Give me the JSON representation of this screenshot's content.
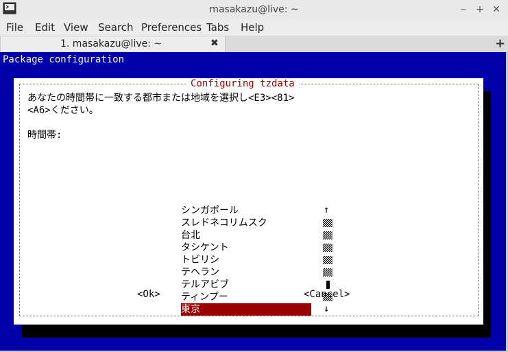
{
  "window": {
    "title": "masakazu@live: ~"
  },
  "menu": [
    "File",
    "Edit",
    "View",
    "Search",
    "Preferences",
    "Tabs",
    "Help"
  ],
  "tabs": [
    {
      "label": "1. masakazu@live: ~",
      "close_glyph": "✖"
    }
  ],
  "new_tab_glyph": "+",
  "terminal": {
    "header": "Package configuration",
    "dialog": {
      "title": "Configuring tzdata",
      "prompt_line1": "あなたの時間帯に一致する都市または地域を選択し<E3><81>",
      "prompt_line2": "<A6>ください。",
      "field_label": "時間帯:",
      "options": [
        "シンガポール",
        "スレドネコリムスク",
        "台北",
        "タシケント",
        "トビリシ",
        "テヘラン",
        "テルアビブ",
        "ティンプー",
        "東京"
      ],
      "selected_index": 8,
      "scroll_up": "↑",
      "scroll_down": "↓",
      "ok_button": "<Ok>",
      "cancel_button": "<Cancel>"
    }
  },
  "colors": {
    "terminal_bg": "#0000aa",
    "selection_bg": "#9b0000",
    "title_color": "#a00000"
  }
}
